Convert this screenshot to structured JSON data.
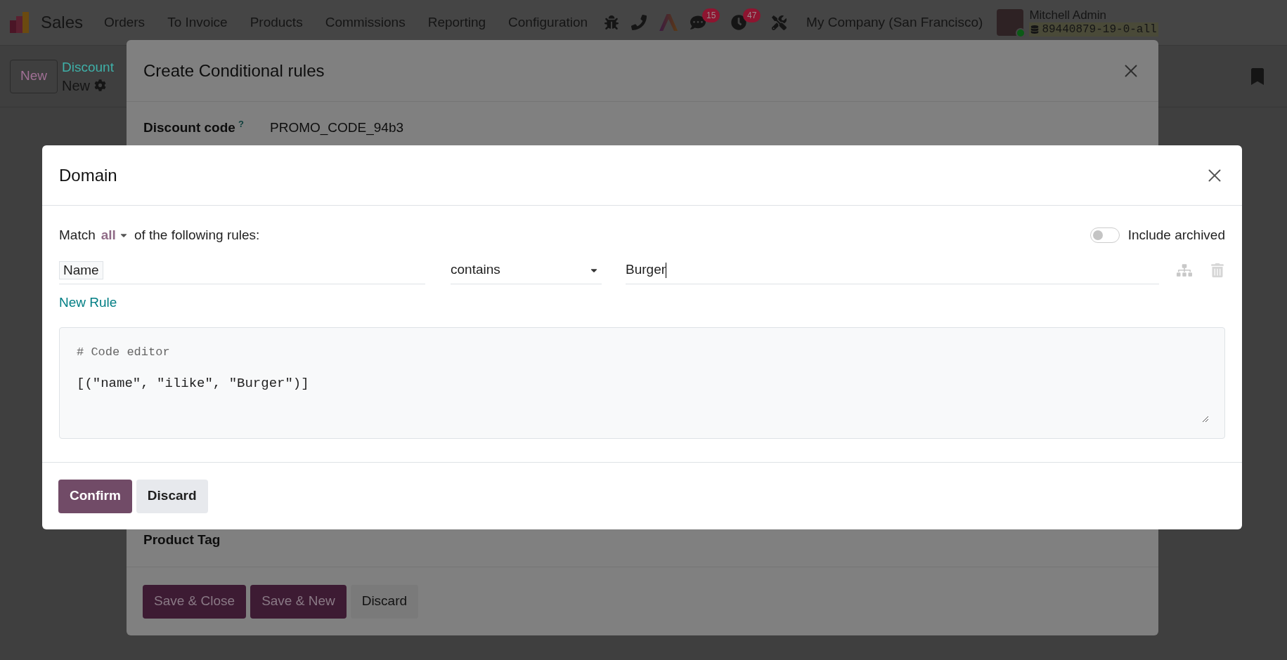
{
  "navbar": {
    "app": "Sales",
    "menu": [
      "Orders",
      "To Invoice",
      "Products",
      "Commissions",
      "Reporting",
      "Configuration"
    ],
    "badges": [
      {
        "kind": "chat",
        "count": "15"
      },
      {
        "kind": "activity",
        "count": "47"
      }
    ],
    "company": "My Company (San Francisco)",
    "user": {
      "name": "Mitchell Admin",
      "database": "89440879-19-0-all"
    }
  },
  "control_panel": {
    "new_button": "New",
    "breadcrumb": "Discount",
    "record": "New"
  },
  "form_dialog": {
    "title": "Create Conditional rules",
    "fields": [
      {
        "label": "Discount code",
        "help": "?",
        "value": "PROMO_CODE_94b3"
      },
      {
        "label": "Product Tag"
      }
    ],
    "buttons": [
      {
        "label": "Save & Close",
        "kind": "primary"
      },
      {
        "label": "Save & New",
        "kind": "primary"
      },
      {
        "label": "Discard",
        "kind": "secondary"
      }
    ]
  },
  "domain_dialog": {
    "title": "Domain",
    "match_prefix": "Match",
    "match_value": "all",
    "match_suffix": "of the following rules:",
    "include_archived": {
      "label": "Include archived",
      "on": false
    },
    "rules": [
      {
        "path": "Name",
        "operator": "contains",
        "value": "Burger"
      }
    ],
    "new_rule": "New Rule",
    "code_editor": {
      "comment": "# Code editor",
      "code": "[(\"name\", \"ilike\", \"Burger\")]"
    },
    "buttons": [
      {
        "label": "Confirm",
        "kind": "primary"
      },
      {
        "label": "Discard",
        "kind": "secondary"
      }
    ]
  }
}
